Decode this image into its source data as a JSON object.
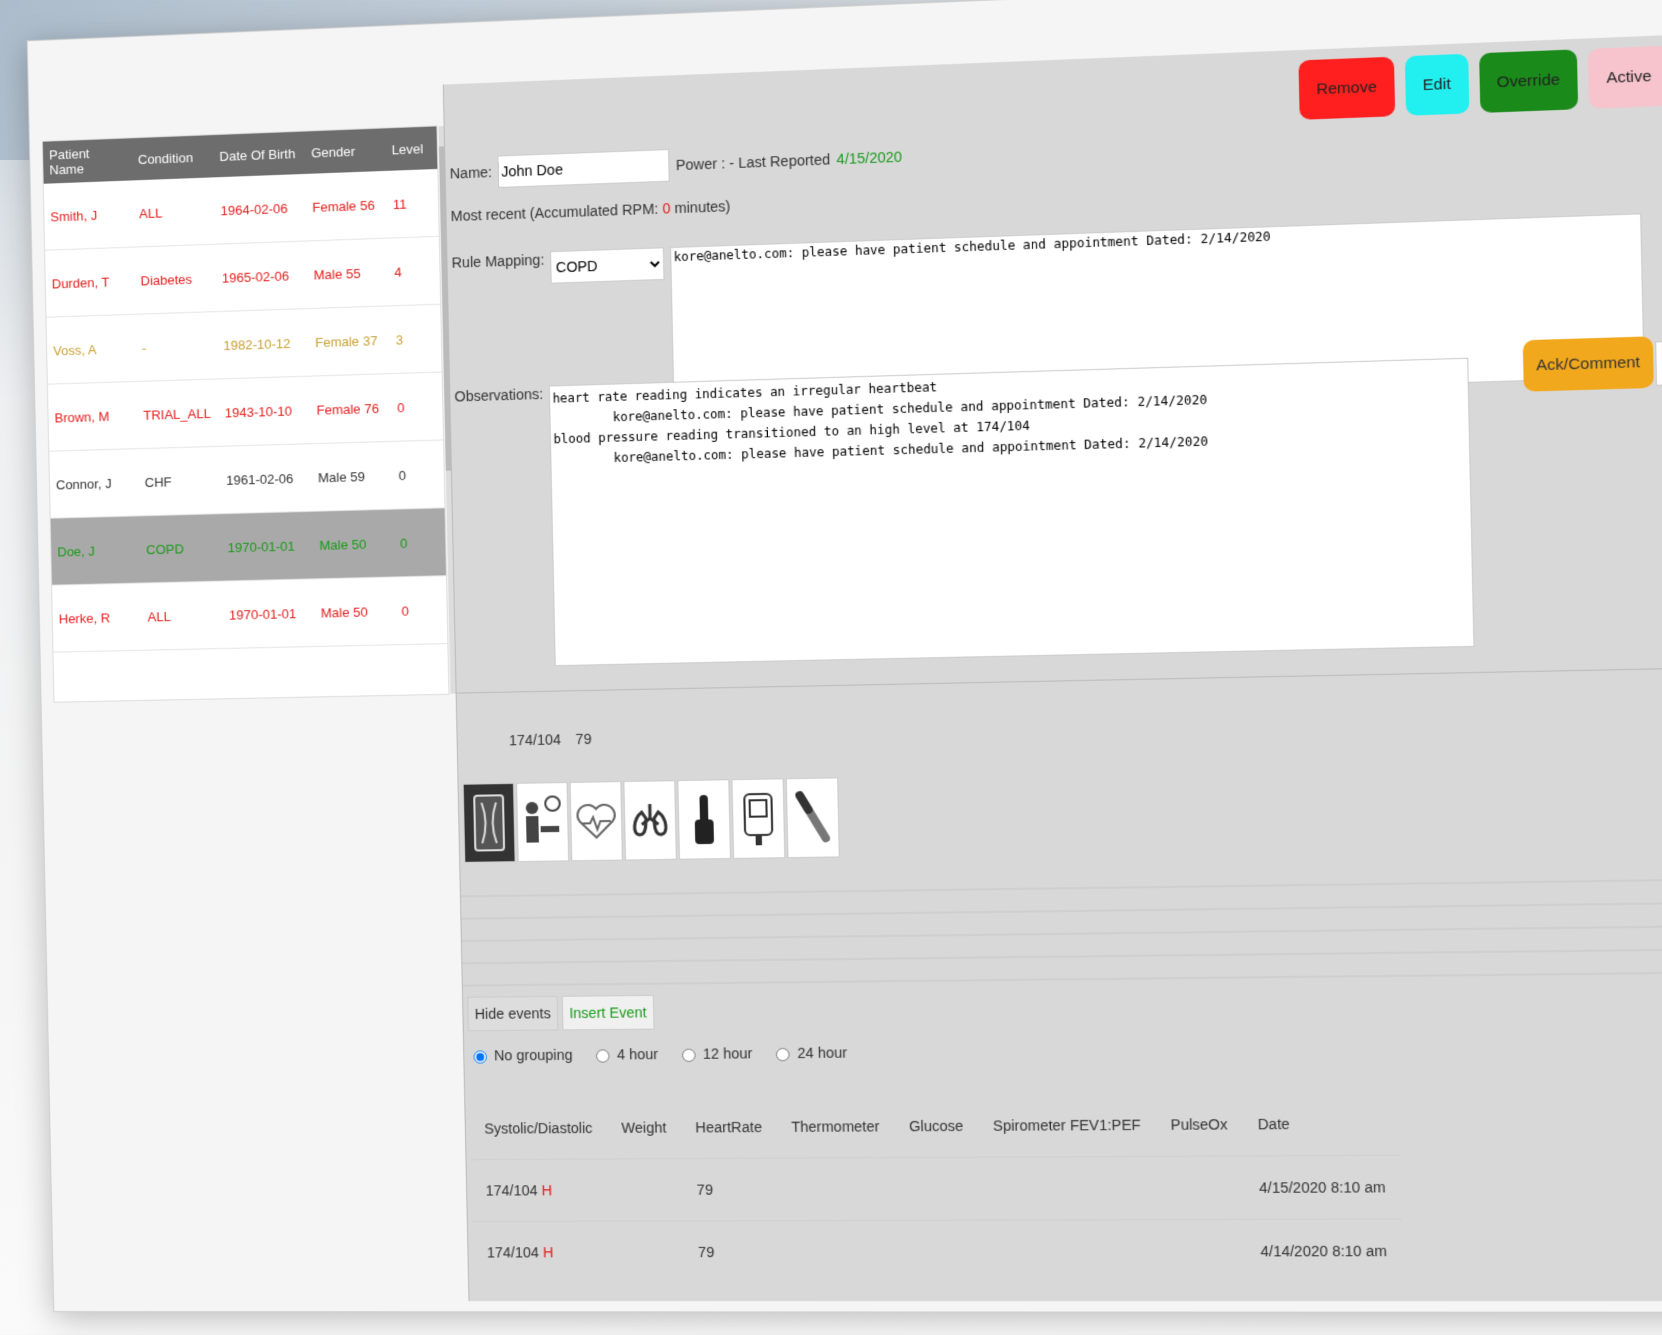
{
  "patient_list": {
    "headers": [
      "Patient Name",
      "Condition",
      "Date Of Birth",
      "Gender",
      "Level"
    ],
    "rows": [
      {
        "name": "Smith, J",
        "condition": "ALL",
        "dob": "1964-02-06",
        "gender": "Female 56",
        "level": "11",
        "color": "#e51c1c"
      },
      {
        "name": "Durden, T",
        "condition": "Diabetes",
        "dob": "1965-02-06",
        "gender": "Male 55",
        "level": "4",
        "color": "#e51c1c"
      },
      {
        "name": "Voss, A",
        "condition": "-",
        "dob": "1982-10-12",
        "gender": "Female 37",
        "level": "3",
        "color": "#c8a030"
      },
      {
        "name": "Brown, M",
        "condition": "TRIAL_ALL",
        "dob": "1943-10-10",
        "gender": "Female 76",
        "level": "0",
        "color": "#e51c1c"
      },
      {
        "name": "Connor, J",
        "condition": "CHF",
        "dob": "1961-02-06",
        "gender": "Male 59",
        "level": "0",
        "color": "#333333"
      },
      {
        "name": "Doe, J",
        "condition": "COPD",
        "dob": "1970-01-01",
        "gender": "Male 50",
        "level": "0",
        "color": "#1a9a1a",
        "selected": true
      },
      {
        "name": "Herke, R",
        "condition": "ALL",
        "dob": "1970-01-01",
        "gender": "Male 50",
        "level": "0",
        "color": "#e51c1c"
      }
    ]
  },
  "actions": {
    "remove": "Remove",
    "edit": "Edit",
    "override": "Override",
    "active": "Active"
  },
  "detail": {
    "name_label": "Name:",
    "name_value": "John Doe",
    "power_label": "Power : - Last Reported",
    "last_reported": "4/15/2020",
    "recent_prefix": "Most recent (Accumulated RPM:",
    "recent_minutes": "0",
    "recent_suffix": "minutes)",
    "rule_label": "Rule Mapping:",
    "rule_value": "COPD",
    "rule_text": "kore@anelto.com: please have patient schedule and appointment Dated: 2/14/2020",
    "obs_label": "Observations:",
    "obs_text": "heart rate reading indicates an irregular heartbeat\n        kore@anelto.com: please have patient schedule and appointment Dated: 2/14/2020\nblood pressure reading transitioned to an high level at 174/104\n        kore@anelto.com: please have patient schedule and appointment Dated: 2/14/2020",
    "ack_label": "Ack/Comment",
    "vital_bp": "174/104",
    "vital_hr": "79"
  },
  "devices": [
    "scale-icon",
    "blood-pressure-icon",
    "heart-icon",
    "lungs-icon",
    "finger-pulse-icon",
    "glucose-meter-icon",
    "thermometer-icon"
  ],
  "events": {
    "hide_label": "Hide events",
    "insert_label": "Insert Event",
    "grouping": [
      "No grouping",
      "4 hour",
      "12 hour",
      "24 hour"
    ],
    "columns": [
      "Systolic/Diastolic",
      "Weight",
      "HeartRate",
      "Thermometer",
      "Glucose",
      "Spirometer FEV1:PEF",
      "PulseOx",
      "Date"
    ],
    "rows": [
      {
        "bp": "174/104",
        "flag": "H",
        "hr": "79",
        "date": "4/15/2020 8:10 am"
      },
      {
        "bp": "174/104",
        "flag": "H",
        "hr": "79",
        "date": "4/14/2020 8:10 am"
      }
    ]
  }
}
